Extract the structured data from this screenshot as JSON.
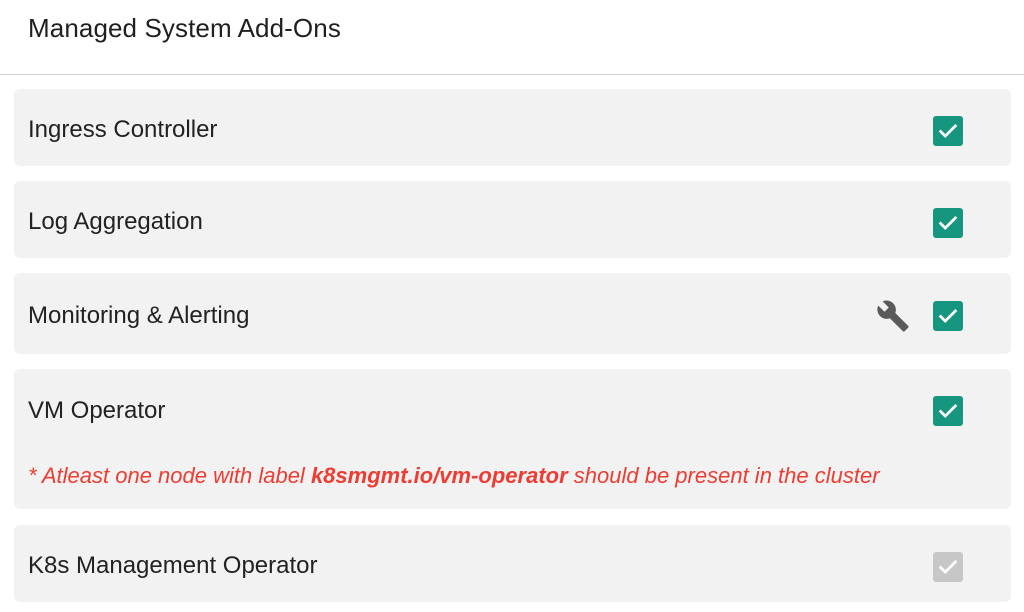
{
  "header": {
    "title": "Managed System Add-Ons"
  },
  "addons": [
    {
      "label": "Ingress Controller",
      "checked": true,
      "disabled": false
    },
    {
      "label": "Log Aggregation",
      "checked": true,
      "disabled": false
    },
    {
      "label": "Monitoring & Alerting",
      "checked": true,
      "disabled": false,
      "has_settings": true,
      "settings_icon": "wrench-icon"
    },
    {
      "label": "VM Operator",
      "checked": true,
      "disabled": false,
      "note": {
        "prefix": "* Atleast one node with label ",
        "highlight": "k8smgmt.io/vm-operator",
        "suffix": " should be present in the cluster"
      }
    },
    {
      "label": "K8s Management Operator",
      "checked": true,
      "disabled": true
    }
  ],
  "colors": {
    "checkbox_active": "#16967f",
    "checkbox_disabled": "#c7c7c7",
    "warning_text": "#ee3c32",
    "row_bg": "#f2f2f2"
  }
}
